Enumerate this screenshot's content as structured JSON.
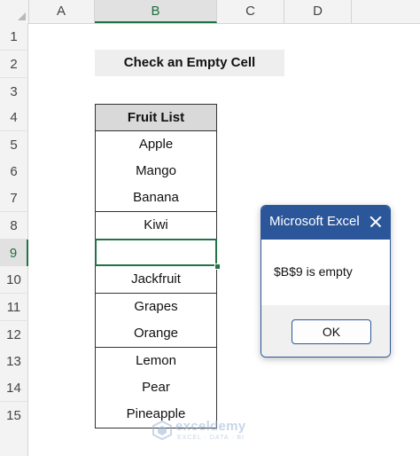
{
  "sheet": {
    "columns": [
      "A",
      "B",
      "C",
      "D"
    ],
    "selected_column": "B",
    "rows": [
      "1",
      "2",
      "3",
      "4",
      "5",
      "6",
      "7",
      "8",
      "9",
      "10",
      "11",
      "12",
      "13",
      "14",
      "15"
    ],
    "selected_row": "9"
  },
  "title_cell": "Check an Empty Cell",
  "fruit_table": {
    "header": "Fruit List",
    "rows": [
      "Apple",
      "Mango",
      "Banana",
      "Kiwi",
      "",
      "Jackfruit",
      "Grapes",
      "Orange",
      "Lemon",
      "Pear",
      "Pineapple"
    ]
  },
  "dialog": {
    "title": "Microsoft Excel",
    "message": "$B$9 is empty",
    "ok_label": "OK"
  },
  "watermark": {
    "name": "exceldemy",
    "tagline": "EXCEL · DATA · BI"
  },
  "colors": {
    "excel_green": "#217346",
    "dialog_blue": "#2b579a"
  }
}
